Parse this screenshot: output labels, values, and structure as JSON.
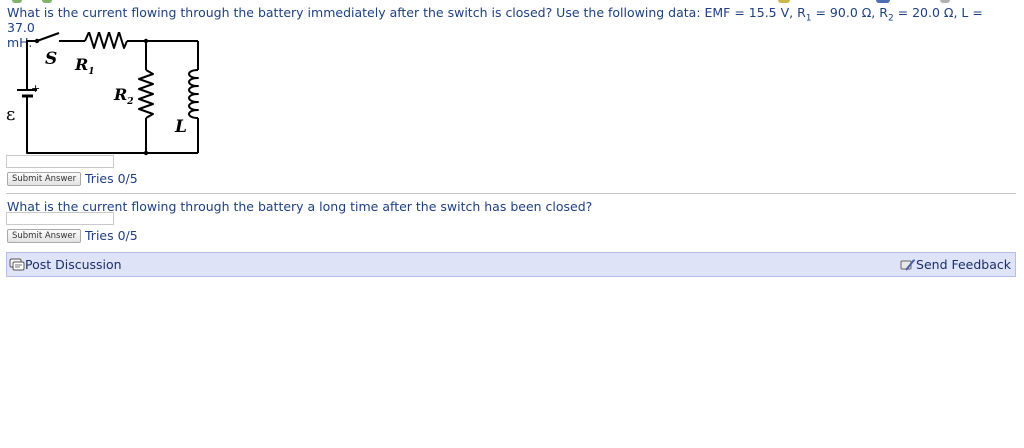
{
  "question1": {
    "prefix": "What is the current flowing through the battery immediately after the switch is closed? Use the following data: EMF = 15.5 V, R",
    "r1_sub": "1",
    "mid1": " = 90.0 Ω, R",
    "r2_sub": "2",
    "mid2": " = 20.0 Ω, L = 37.0",
    "suffix": "mH.",
    "submit_label": "Submit Answer",
    "tries": "Tries 0/5"
  },
  "circuit": {
    "switch_label": "S",
    "r1_label": "R",
    "r1_sub": "1",
    "r2_label": "R",
    "r2_sub": "2",
    "inductor_label": "L",
    "emf_label": "ε",
    "plus_label": "+"
  },
  "question2": {
    "text": "What is the current flowing through the battery a long time after the switch has been closed?",
    "submit_label": "Submit Answer",
    "tries": "Tries 0/5"
  },
  "footer": {
    "post_discussion": "Post Discussion",
    "send_feedback": "Send Feedback"
  }
}
